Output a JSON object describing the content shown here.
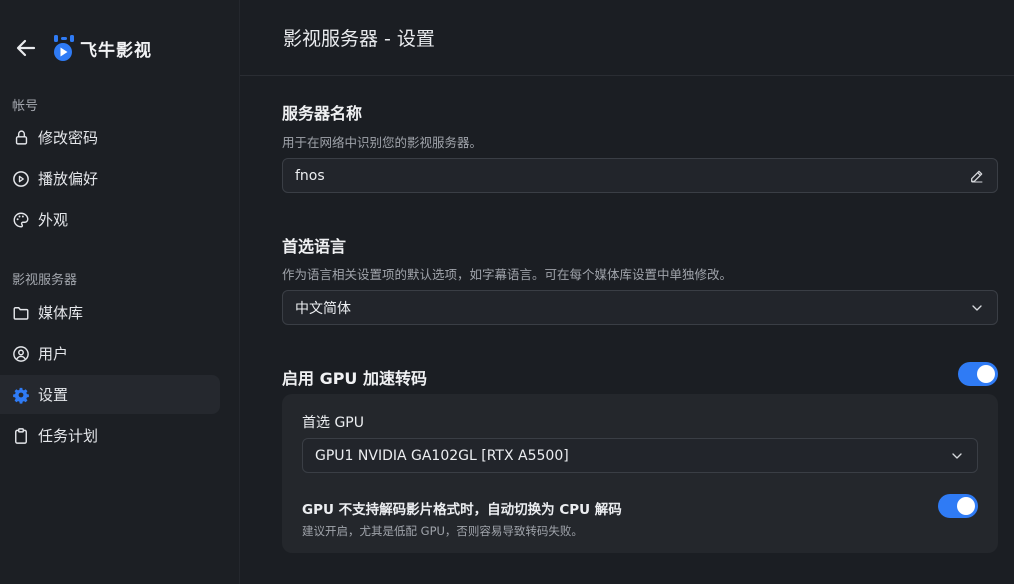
{
  "sidebar": {
    "brand_name": "飞牛影视",
    "section_account": "帐号",
    "section_server": "影视服务器",
    "items": [
      {
        "label": "修改密码",
        "icon": "lock-icon"
      },
      {
        "label": "播放偏好",
        "icon": "play-circle-icon"
      },
      {
        "label": "外观",
        "icon": "palette-icon"
      },
      {
        "label": "媒体库",
        "icon": "folder-icon"
      },
      {
        "label": "用户",
        "icon": "user-circle-icon"
      },
      {
        "label": "设置",
        "icon": "gear-icon",
        "active": true
      },
      {
        "label": "任务计划",
        "icon": "clipboard-icon"
      }
    ]
  },
  "header": {
    "title": "影视服务器 - 设置"
  },
  "server_name": {
    "title": "服务器名称",
    "desc": "用于在网络中识别您的影视服务器。",
    "value": "fnos"
  },
  "language": {
    "title": "首选语言",
    "desc": "作为语言相关设置项的默认选项，如字幕语言。可在每个媒体库设置中单独修改。",
    "value": "中文简体"
  },
  "gpu": {
    "title": "启用 GPU 加速转码",
    "enabled": true,
    "preferred_label": "首选 GPU",
    "preferred_value": "GPU1 NVIDIA GA102GL [RTX A5500]",
    "fallback_label": "GPU 不支持解码影片格式时，自动切换为 CPU 解码",
    "fallback_enabled": true,
    "fallback_note": "建议开启，尤其是低配 GPU，否则容易导致转码失败。"
  },
  "colors": {
    "accent": "#2f7bf5",
    "bg": "#1b1e23",
    "panel": "#24272c"
  }
}
